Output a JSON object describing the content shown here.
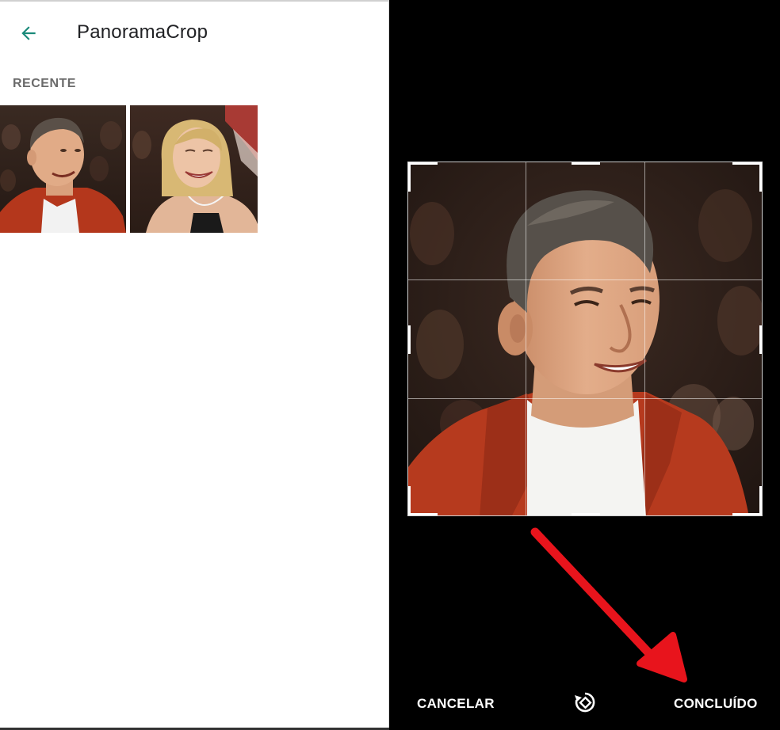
{
  "left_screen": {
    "header": {
      "back_icon": "arrow-left-icon",
      "title": "PanoramaCrop"
    },
    "section_label": "RECENTE",
    "thumbnails": [
      {
        "subject": "man-red-jacket-photo"
      },
      {
        "subject": "blonde-woman-photo"
      }
    ]
  },
  "right_screen": {
    "crop_editor": {
      "image": "man-red-jacket-photo",
      "grid": "3x3"
    },
    "actions": {
      "cancel_label": "CANCELAR",
      "rotate_icon": "rotate-icon",
      "done_label": "CONCLUÍDO"
    },
    "annotation": {
      "type": "arrow",
      "color": "#e8141c",
      "points_to": "done-button"
    }
  },
  "colors": {
    "accent_teal": "#1a8a7a",
    "title_text": "#202124",
    "section_label": "#6b6b6b",
    "editor_background": "#000000",
    "annotation_red": "#e8141c"
  }
}
